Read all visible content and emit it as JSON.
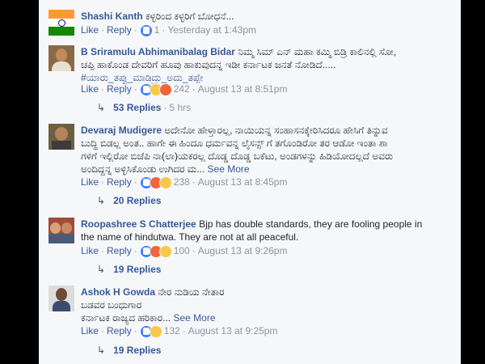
{
  "comments": [
    {
      "author": "Shashi Kanth",
      "text": "ಕಳ್ಳರಿಂದ ಕಳ್ಳರಿಗೆ ಬೋಧನೆ...",
      "like": "Like",
      "reply": "Reply",
      "reaction_count": "1",
      "time": "Yesterday at 1:43pm",
      "avatar": "india-flag"
    },
    {
      "author": "B Sriramulu Abhimanibalag Bidar",
      "text_line1": "ನಿಮ್ಮ ಸಿಮ್ ಎನ್ ಮಹಾ ಕಮ್ಮಿ ಬಿಡ್ರಿ ಕಾಲಿನಲ್ಲಿ ಸೋ,",
      "text_line2": "ಚಪ್ಪಿ ಹಾಕೊಂಡ ದೇವರಿಗೆ ಹೂವು ಹಾಕುವುದನ್ನ ಇಡೀ ಕರ್ನಾಟಕ ಜನತೆ ನೋಡಿದೆ.....",
      "hashtag": "#ಯಾರು_ತಪ್ಪು_ಮಾಡಿದ್ರು_ಅದು_ತಪ್ಪೇ",
      "like": "Like",
      "reply": "Reply",
      "reaction_count": "242",
      "time": "August 13 at 8:51pm",
      "replies": "53 Replies",
      "replies_time": "5 hrs"
    },
    {
      "author": "Devaraj Mudigere",
      "text_line1": "ಅದೇನೋ ಹೇಳ್ತಾರಲ್ಲ, ನಾಯಿಯನ್ನ ಸಂಹಾಸನಕ್ಕೇರಿಸಿದರೂ ಹೇಸಿಗೆ ತಿನ್ನುವ",
      "text_line2": "ಬುದ್ಧಿ ಬಿಡಲ್ಲ ಅಂತ.. ಹಾಗೇ ಈ ಹಿಂದೂ ಧರ್ಮವನ್ನ ಲೈಸನ್ಸ್ ಗೆ ತಗೊಂಡಿರೋ ತರ ಆಡೋ ಇಂತಾ ಶಾ",
      "text_line3": "ಗಳಿಗೆ ಇಲ್ಲಿರೋ ಬಿಜೆಪಿ ನಾ(ಲಾ)ಯಕರಲ್ಲ ದೊಡ್ಡ ದೊಡ್ಡ ಬಕೆಟು, ಅಂಡಗಳನ್ನು ಹಿಡಿಯೋದಲ್ಲದೆ ಅವರು",
      "text_line4": "ಅಂದಿದ್ದನ್ನ ಅಳ್ಳಿಸಿಕೊಂಡು ಉಗಿದರ ಮ...",
      "see_more": "See More",
      "like": "Like",
      "reply": "Reply",
      "reaction_count": "238",
      "time": "August 13 at 8:45pm",
      "replies": "20 Replies"
    },
    {
      "author": "Roopashree S Chatterjee",
      "text_line1": "Bjp has double standards, they are fooling people in",
      "text_line2": "the name of hindutwa. They are not at all peaceful.",
      "like": "Like",
      "reply": "Reply",
      "reaction_count": "100",
      "time": "August 13 at 9:26pm",
      "replies": "19 Replies"
    },
    {
      "author": "Ashok H Gowda",
      "text_line1": "ನೇರ ನುಡಿಯ ನೇತಾರ",
      "text_line2": "ಬಡವರ ಬಂಧುಗಾರ",
      "text_line3": "ಕರ್ನಾಟಕ ರಾಜ್ಯದ ಹರಿಕಾರ...",
      "see_more": "See More",
      "like": "Like",
      "reply": "Reply",
      "reaction_count": "132",
      "time": "August 13 at 9:25pm",
      "replies": "19 Replies"
    }
  ],
  "colors": {
    "author": "#365899",
    "meta": "#90949c",
    "panel": "#f6f7f9",
    "like_reaction": "#4080ff"
  }
}
